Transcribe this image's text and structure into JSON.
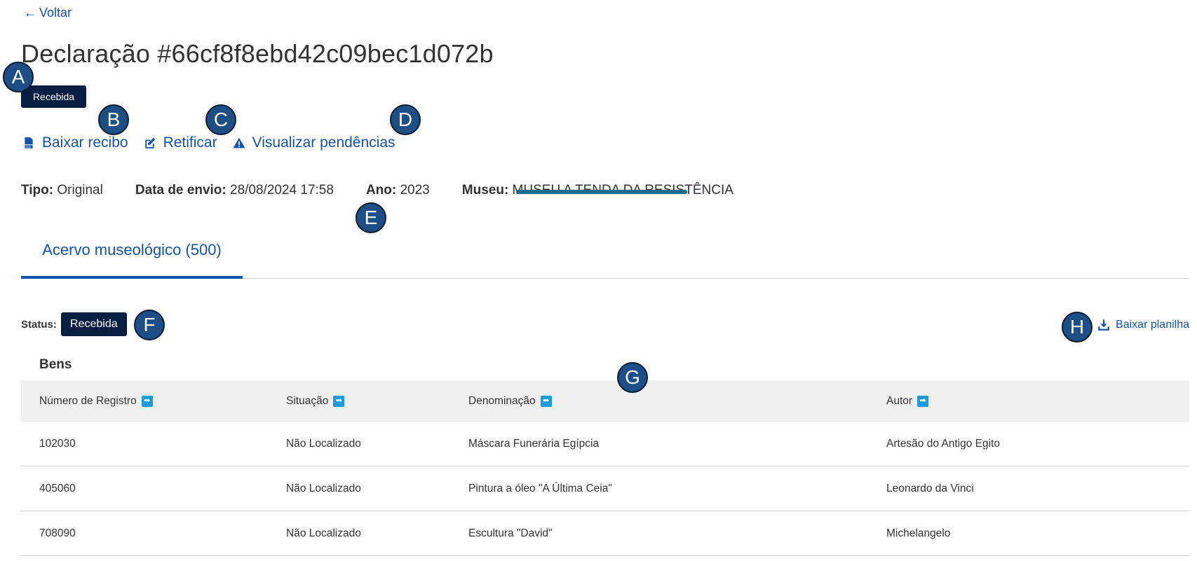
{
  "back": {
    "label": "Voltar"
  },
  "page": {
    "title": "Declaração #66cf8f8ebd42c09bec1d072b",
    "badge": "Recebida"
  },
  "actions": {
    "download_receipt": "Baixar recibo",
    "rectify": "Retificar",
    "view_pending": "Visualizar pendências"
  },
  "meta": {
    "type_label": "Tipo:",
    "type_value": "Original",
    "sent_label": "Data de envio:",
    "sent_value": "28/08/2024 17:58",
    "year_label": "Ano:",
    "year_value": "2023",
    "museum_label": "Museu:",
    "museum_value": "MUSEU A TENDA DA RESISTÊNCIA"
  },
  "tabs": {
    "active": "Acervo museológico (500)"
  },
  "status": {
    "label": "Status:",
    "value": "Recebida"
  },
  "download_sheet": "Baixar planilha",
  "section": {
    "title": "Bens"
  },
  "table": {
    "headers": [
      "Número de Registro",
      "Situação",
      "Denominação",
      "Autor"
    ],
    "rows": [
      [
        "102030",
        "Não Localizado",
        "Máscara Funerária Egípcia",
        "Artesão do Antigo Egito"
      ],
      [
        "405060",
        "Não Localizado",
        "Pintura a óleo \"A Última Ceia\"",
        "Leonardo da Vinci"
      ],
      [
        "708090",
        "Não Localizado",
        "Escultura \"David\"",
        "Michelangelo"
      ]
    ]
  },
  "markers": [
    "A",
    "B",
    "C",
    "D",
    "E",
    "F",
    "G",
    "H"
  ],
  "colors": {
    "primary": "#1351b4",
    "badge": "#071d41",
    "marker": "#1d4f86",
    "sort": "#1a9be0"
  }
}
